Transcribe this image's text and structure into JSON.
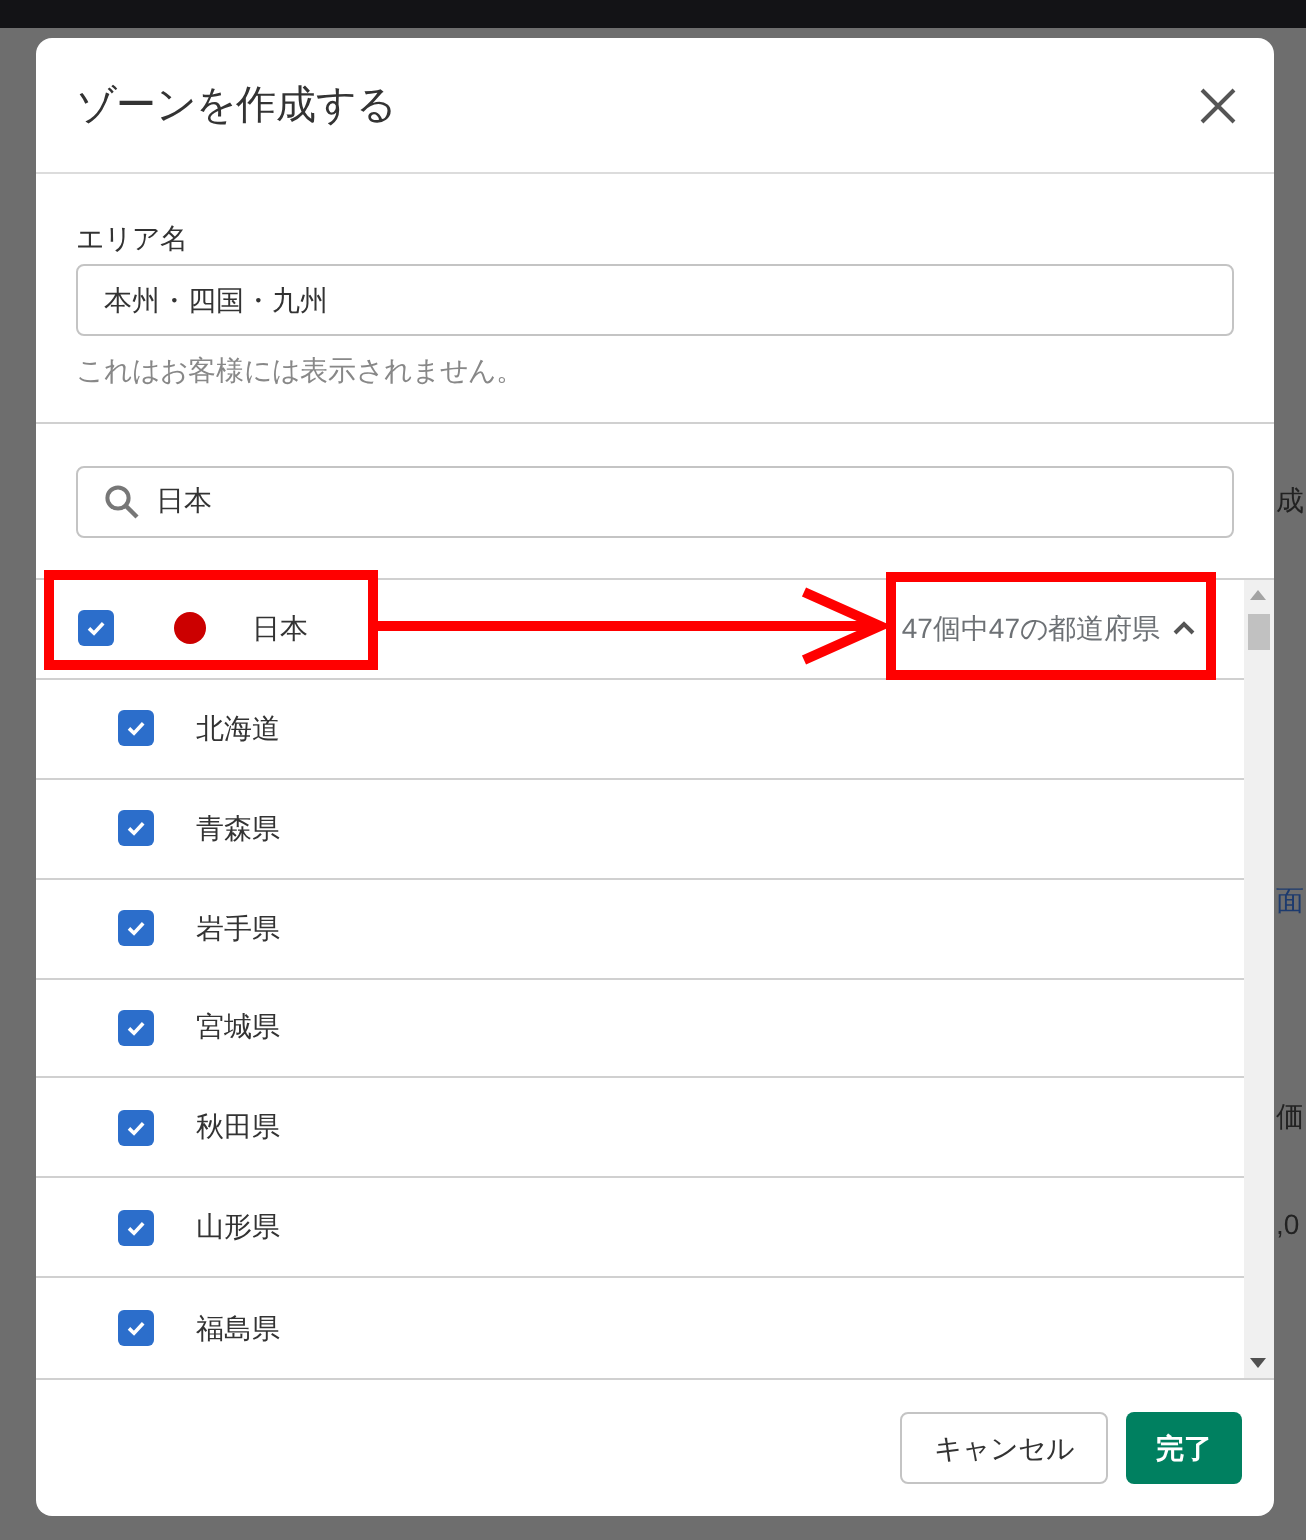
{
  "background_page": {
    "fragments": [
      {
        "text": "成",
        "kind": "plain"
      },
      {
        "text": "面",
        "kind": "link"
      },
      {
        "text": "価",
        "kind": "plain"
      },
      {
        "text": ",0",
        "kind": "plain"
      }
    ]
  },
  "dialog": {
    "title": "ゾーンを作成する",
    "area_name": {
      "label": "エリア名",
      "value": "本州・四国・九州",
      "help": "これはお客様には表示されません。"
    },
    "search": {
      "value": "日本"
    },
    "country": {
      "name": "日本",
      "checked": true,
      "color": "#cc0000",
      "count": "47個中47の都道府県",
      "expanded": true
    },
    "regions": [
      {
        "name": "北海道",
        "checked": true
      },
      {
        "name": "青森県",
        "checked": true
      },
      {
        "name": "岩手県",
        "checked": true
      },
      {
        "name": "宮城県",
        "checked": true
      },
      {
        "name": "秋田県",
        "checked": true
      },
      {
        "name": "山形県",
        "checked": true
      },
      {
        "name": "福島県",
        "checked": true
      }
    ],
    "buttons": [
      {
        "label": "キャンセル",
        "kind": "secondary"
      },
      {
        "label": "完了",
        "kind": "primary"
      }
    ]
  }
}
